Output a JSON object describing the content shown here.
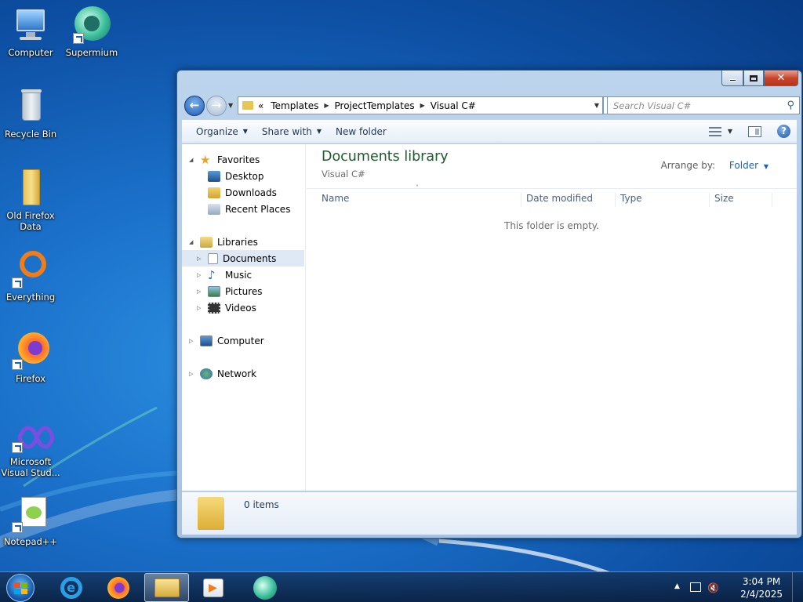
{
  "desktop": {
    "icons": [
      {
        "label": "Computer"
      },
      {
        "label": "Supermium"
      },
      {
        "label": "Recycle Bin"
      },
      {
        "label": "Old Firefox Data"
      },
      {
        "label": "Everything"
      },
      {
        "label": "Firefox"
      },
      {
        "label": "Microsoft Visual Stud..."
      },
      {
        "label": "Notepad++"
      }
    ]
  },
  "window": {
    "caption": {
      "close_glyph": "✕"
    },
    "address": {
      "overflow": "«",
      "crumbs": [
        "Templates",
        "ProjectTemplates",
        "Visual C#"
      ]
    },
    "search": {
      "placeholder": "Search Visual C#"
    },
    "toolbar": {
      "organize": "Organize",
      "share_with": "Share with",
      "new_folder": "New folder"
    },
    "nav": {
      "favorites": "Favorites",
      "desktop": "Desktop",
      "downloads": "Downloads",
      "recent_places": "Recent Places",
      "libraries": "Libraries",
      "documents": "Documents",
      "music": "Music",
      "pictures": "Pictures",
      "videos": "Videos",
      "computer": "Computer",
      "network": "Network"
    },
    "main": {
      "title": "Documents library",
      "subtitle": "Visual C#",
      "arrange_label": "Arrange by:",
      "arrange_value": "Folder",
      "columns": [
        "Name",
        "Date modified",
        "Type",
        "Size"
      ],
      "empty_message": "This folder is empty."
    },
    "details": {
      "count": "0 items"
    }
  },
  "taskbar": {
    "time": "3:04 PM",
    "date": "2/4/2025"
  }
}
